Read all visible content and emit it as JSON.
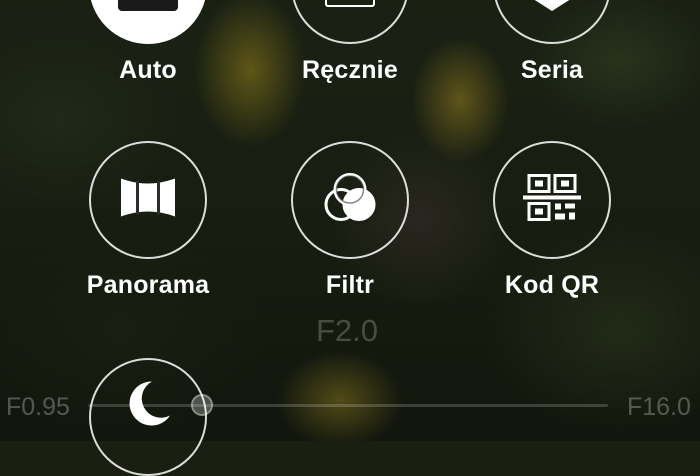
{
  "modes": [
    {
      "label": "Auto",
      "icon": "camera-icon",
      "active": true
    },
    {
      "label": "Ręcznie",
      "icon": "manual-icon",
      "active": false
    },
    {
      "label": "Seria",
      "icon": "burst-icon",
      "active": false
    },
    {
      "label": "Panorama",
      "icon": "panorama-icon",
      "active": false
    },
    {
      "label": "Filtr",
      "icon": "filter-icon",
      "active": false
    },
    {
      "label": "Kod QR",
      "icon": "qr-code-icon",
      "active": false
    },
    {
      "label": "",
      "icon": "night-moon-icon",
      "active": false
    }
  ],
  "aperture": {
    "current": "F2.0",
    "min_label": "F0.95",
    "max_label": "F16.0",
    "position_fraction": 0.22
  },
  "colors": {
    "label": "#ffffff",
    "ring": "#ffffff"
  }
}
